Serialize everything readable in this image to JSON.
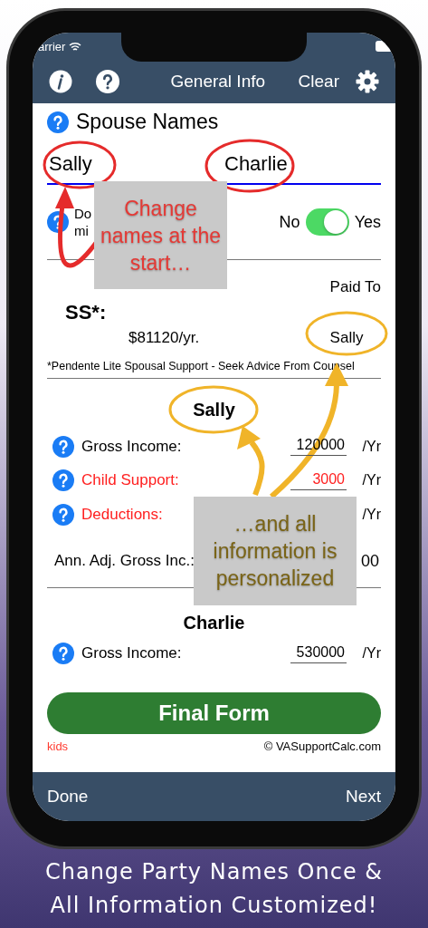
{
  "status_bar": {
    "carrier": "arrier"
  },
  "nav_bar": {
    "title": "General Info",
    "clear": "Clear"
  },
  "spouse_names": {
    "heading": "Spouse Names",
    "names": [
      "Sally",
      "Charlie"
    ]
  },
  "question": {
    "lines": [
      "Do",
      "mi"
    ],
    "off_label": "No",
    "on_label": "Yes",
    "on": true
  },
  "support": {
    "paid_to_label": "Paid To",
    "label": "SS*:",
    "amount": "$81120/yr.",
    "paid_to": "Sally",
    "footnote": "*Pendente Lite Spousal Support - Seek Advice From Counsel"
  },
  "parties": [
    {
      "name": "Sally",
      "rows": [
        {
          "label": "Gross Income:",
          "value": "120000",
          "unit": "/Yr",
          "alert": false
        },
        {
          "label": "Child Support:",
          "value": "3000",
          "unit": "/Yr",
          "alert": true
        },
        {
          "label": "Deductions:",
          "unit": "/Yr",
          "alert": true
        }
      ],
      "total": {
        "label": "Ann. Adj. Gross Inc.:",
        "value": "00"
      }
    },
    {
      "name": "Charlie",
      "rows": [
        {
          "label": "Gross Income:",
          "value": "530000",
          "unit": "/Yr",
          "alert": false
        }
      ]
    }
  ],
  "final_button": "Final Form",
  "kids_link": "kids",
  "copyright": "© VASupportCalc.com",
  "toolbar": {
    "done": "Done",
    "next": "Next"
  },
  "callouts": [
    {
      "text": "Change names at the start…",
      "color": "#e53935"
    },
    {
      "text": "…and all information is personalized",
      "color": "#7a6416"
    }
  ],
  "caption": [
    "Change Party Names Once &",
    "All Information Customized!"
  ]
}
